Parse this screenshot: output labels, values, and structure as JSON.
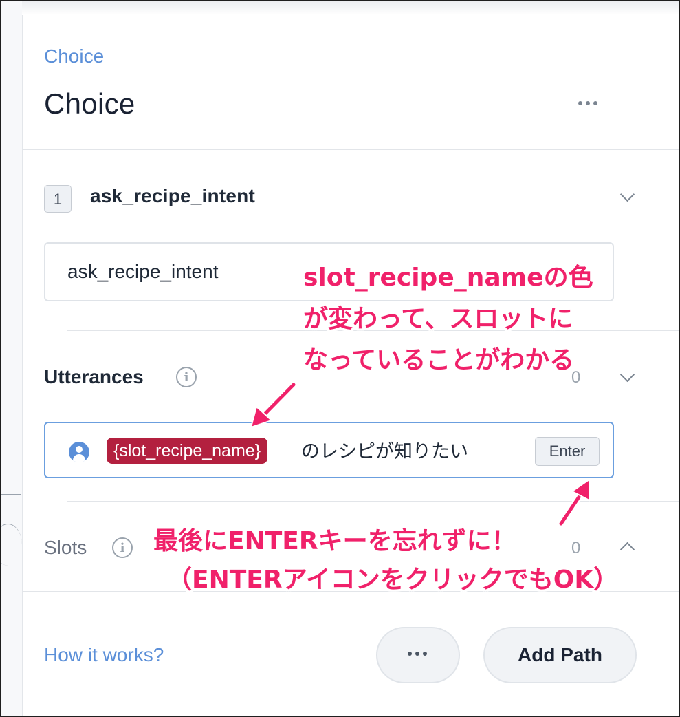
{
  "panel": {
    "breadcrumb": "Choice",
    "title": "Choice"
  },
  "path": {
    "index": "1",
    "intent_name": "ask_recipe_intent",
    "intent_input_value": "ask_recipe_intent"
  },
  "utterances": {
    "label": "Utterances",
    "count": "0",
    "slot_tag": "{slot_recipe_name}",
    "text": "のレシピが知りたい",
    "enter_label": "Enter"
  },
  "slots": {
    "label": "Slots",
    "count": "0"
  },
  "footer": {
    "how_it_works": "How it works?",
    "add_path": "Add Path"
  },
  "annotations": {
    "note1_line1": "slot_recipe_nameの色",
    "note1_line2": "が変わって、スロットに",
    "note1_line3": "なっていることがわかる",
    "note2_line1": "最後にENTERキーを忘れずに！",
    "note2_line2": "（ENTERアイコンをクリックでもOK）"
  },
  "colors": {
    "accent": "#5b8fd8",
    "slot_tag": "#b3203f",
    "annotation": "#f0216a"
  },
  "icons": {
    "more": "more-horizontal-icon",
    "info": "info-icon",
    "user": "user-icon",
    "chevron_down": "chevron-down-icon",
    "chevron_up": "chevron-up-icon"
  }
}
